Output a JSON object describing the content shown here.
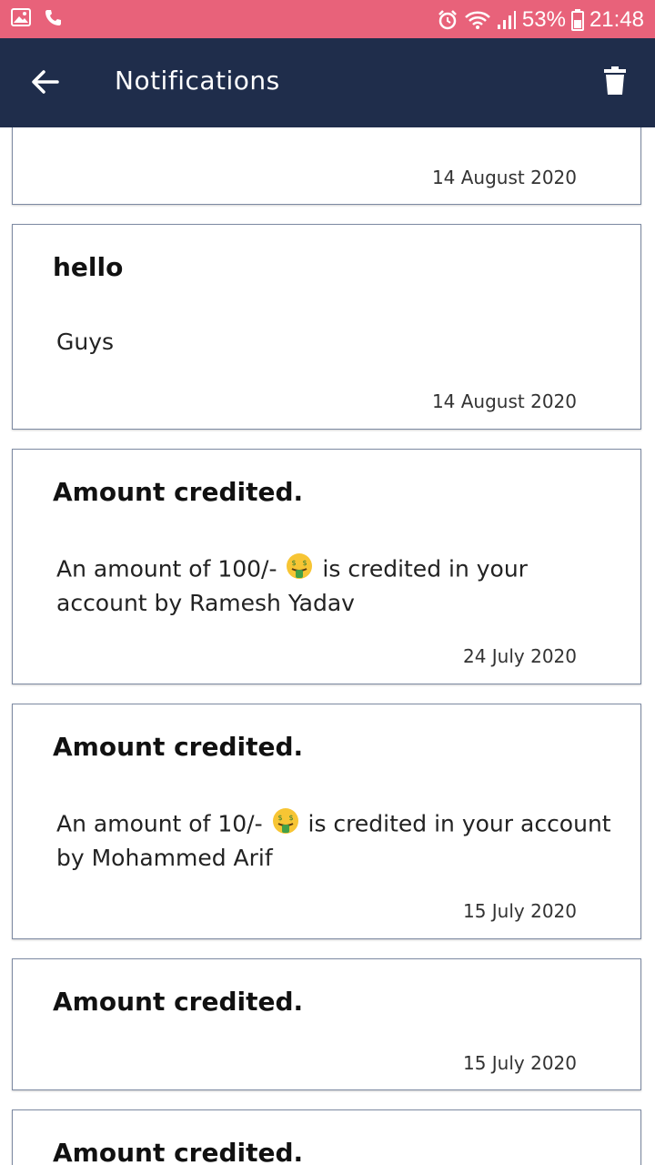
{
  "status_bar": {
    "battery": "53%",
    "time": "21:48"
  },
  "app_bar": {
    "title": "Notifications"
  },
  "notifications": [
    {
      "title": "",
      "body_before": "",
      "body_after": "",
      "date": "14 August 2020"
    },
    {
      "title": "hello",
      "body_before": "Guys",
      "body_after": "",
      "date": "14 August 2020"
    },
    {
      "title": "Amount credited.",
      "body_before": "An amount of 100/-",
      "body_after": "is credited in your account by Ramesh Yadav",
      "date": "24 July 2020"
    },
    {
      "title": "Amount credited.",
      "body_before": "An amount of 10/-",
      "body_after": "is credited in your account by Mohammed Arif",
      "date": "15 July 2020"
    },
    {
      "title": "Amount credited.",
      "body_before": "",
      "body_after": "",
      "date": "15 July 2020"
    },
    {
      "title": "Amount credited.",
      "body_before": "",
      "body_after": "",
      "date": ""
    }
  ],
  "colors": {
    "status_bar": "#e8627a",
    "app_bar": "#1f2d4b",
    "card_border": "#7d8aa2"
  },
  "icons": {
    "back": "arrow-left-icon",
    "delete": "trash-icon",
    "money": "money-mouth-face-emoji"
  }
}
